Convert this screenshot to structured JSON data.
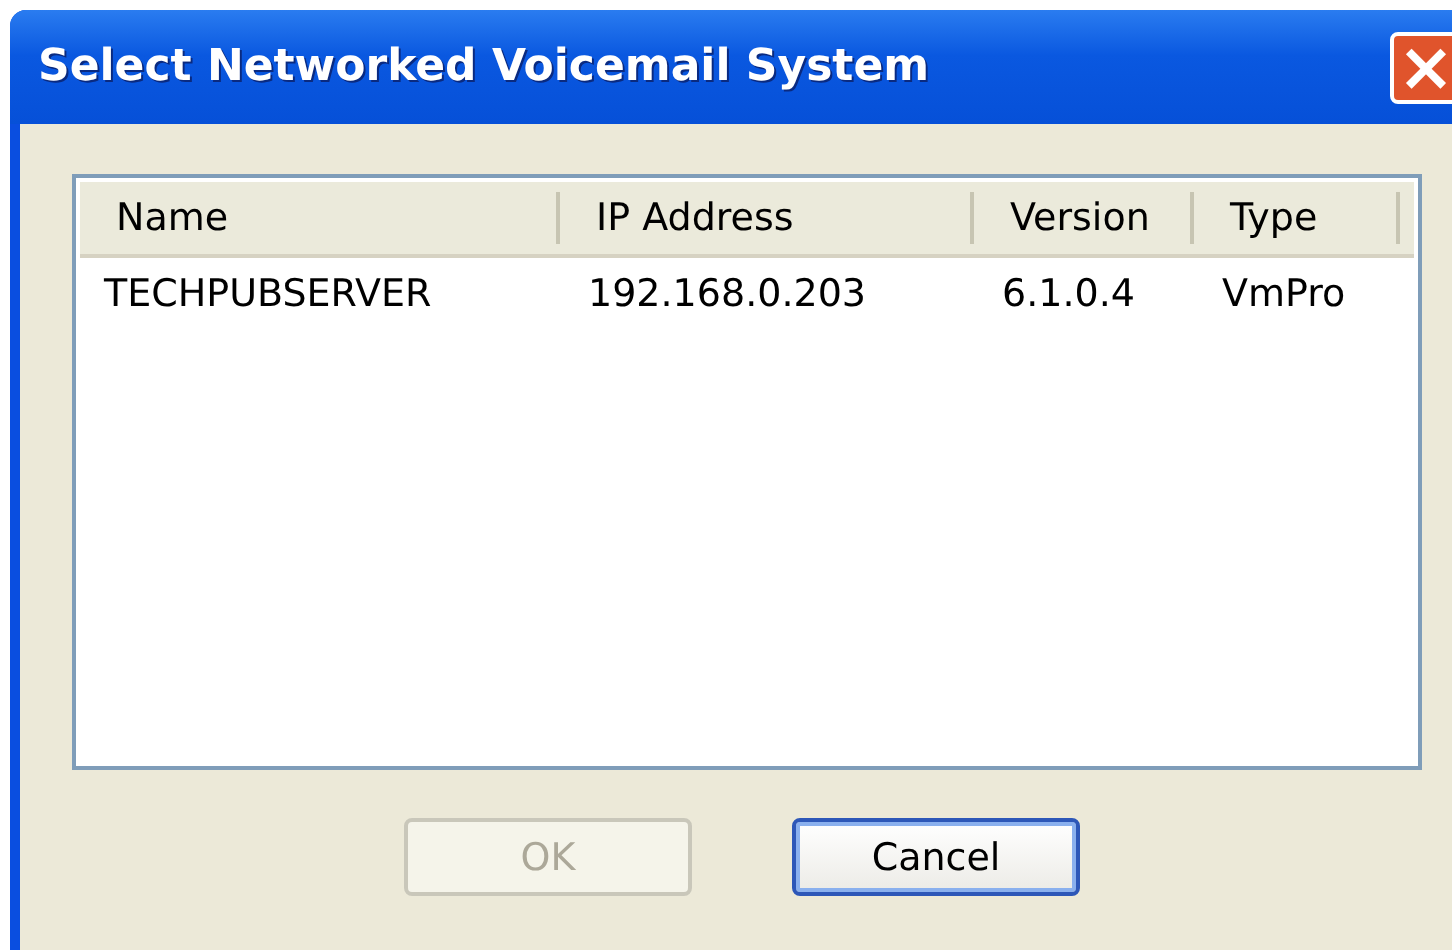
{
  "window": {
    "title": "Select Networked Voicemail System",
    "close": "×"
  },
  "table": {
    "columns": [
      "Name",
      "IP Address",
      "Version",
      "Type"
    ],
    "rows": [
      [
        "TECHPUBSERVER",
        "192.168.0.203",
        "6.1.0.4",
        "VmPro"
      ]
    ]
  },
  "buttons": [
    {
      "label": "OK",
      "disabled": true,
      "default": false
    },
    {
      "label": "Cancel",
      "disabled": false,
      "default": true
    }
  ]
}
